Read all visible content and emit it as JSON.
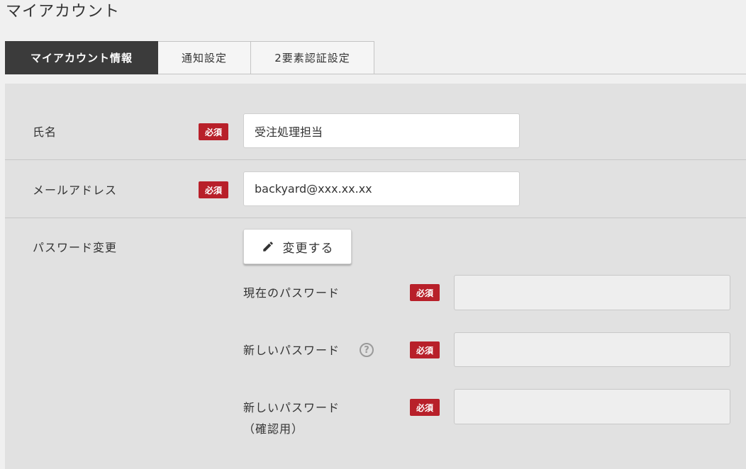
{
  "page": {
    "title": "マイアカウント"
  },
  "tabs": [
    {
      "label": "マイアカウント情報",
      "active": true
    },
    {
      "label": "通知設定",
      "active": false
    },
    {
      "label": "2要素認証設定",
      "active": false
    }
  ],
  "required_badge": "必須",
  "form": {
    "name": {
      "label": "氏名",
      "value": "受注処理担当"
    },
    "email": {
      "label": "メールアドレス",
      "value": "backyard@xxx.xx.xx"
    },
    "password": {
      "label": "パスワード変更",
      "change_button": {
        "label": "変更する",
        "icon": "pencil-icon"
      },
      "current": {
        "label": "現在のパスワード",
        "value": ""
      },
      "new": {
        "label": "新しいパスワード",
        "help_icon": "question-circle-icon",
        "help_glyph": "?",
        "value": ""
      },
      "confirm": {
        "label_line1": "新しいパスワード",
        "label_line2": "（確認用）",
        "value": ""
      }
    }
  },
  "colors": {
    "required_badge": "#b8202a",
    "active_tab_bg": "#3b3b3b",
    "panel_bg": "#e1e1e1",
    "page_bg": "#f0f0f0"
  }
}
